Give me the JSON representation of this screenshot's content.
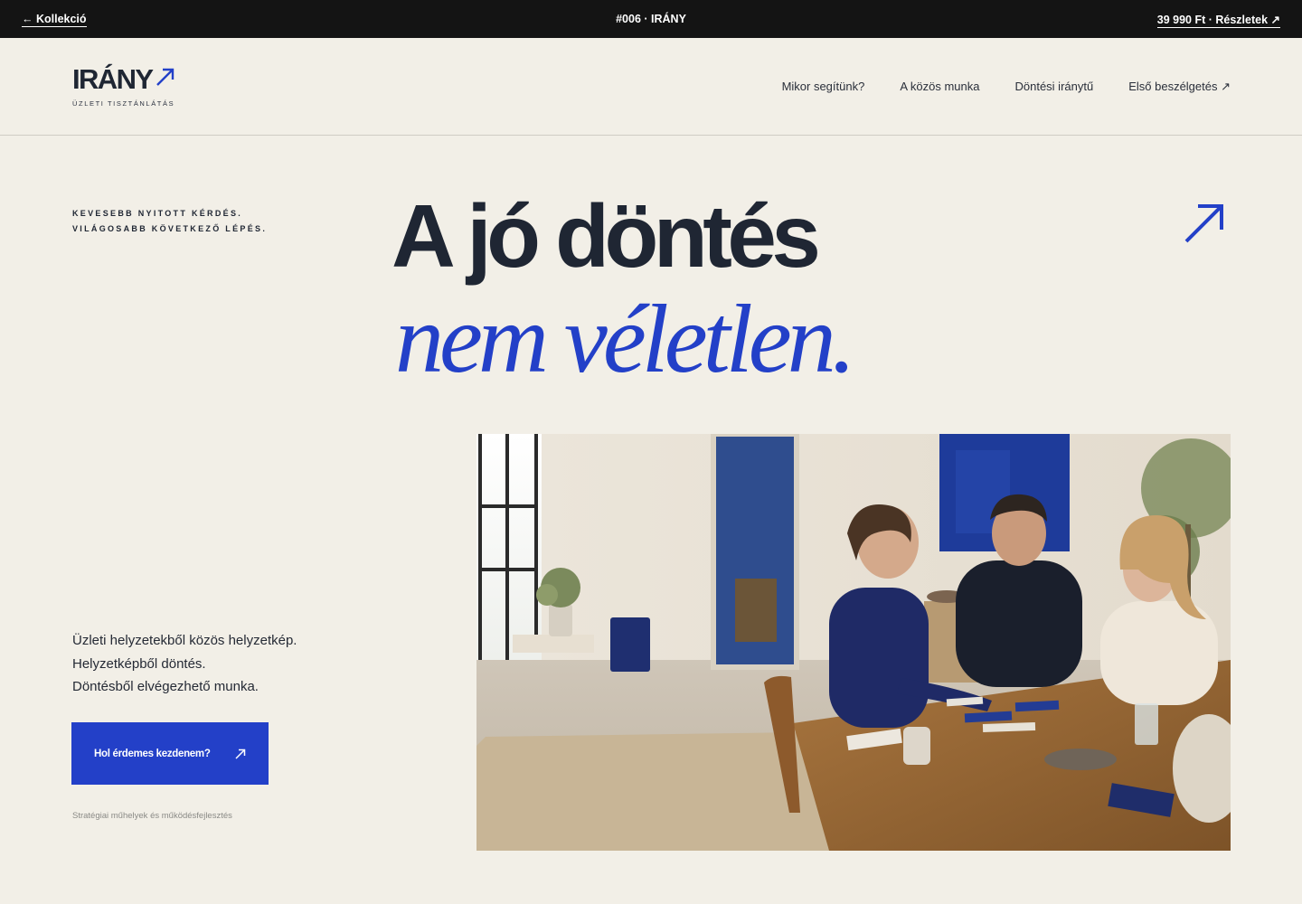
{
  "topbar": {
    "back_label": "← Kollekció",
    "center_label": "#006 · IRÁNY",
    "price_label": "39 990 Ft · Részletek ↗"
  },
  "logo": {
    "wordmark": "IRÁNY",
    "tagline": "ÜZLETI TISZTÁNLÁTÁS"
  },
  "nav": {
    "items": [
      {
        "label": "Mikor segítünk?"
      },
      {
        "label": "A közös munka"
      },
      {
        "label": "Döntési iránytű"
      },
      {
        "label": "Első beszélgetés ↗"
      }
    ]
  },
  "hero": {
    "eyebrow_line1": "KEVESEBB NYITOTT KÉRDÉS.",
    "eyebrow_line2": "VILÁGOSABB KÖVETKEZŐ LÉPÉS.",
    "headline_line1": "A jó döntés",
    "headline_line2": "nem véletlen.",
    "lead_lines": [
      "Üzleti helyzetekből közös helyzetkép.",
      "Helyzetképből döntés.",
      "Döntésből elvégezhető munka."
    ],
    "cta_label": "Hol érdemes kezdenem?",
    "footnote": "Stratégiai műhelyek és működésfejlesztés"
  },
  "colors": {
    "background": "#f2efe7",
    "ink": "#1f2633",
    "accent": "#2340c8",
    "topbar": "#141414"
  },
  "icons": {
    "logo": "arrow-up-right-icon",
    "hero": "arrow-up-right-icon",
    "cta": "arrow-up-right-icon"
  }
}
